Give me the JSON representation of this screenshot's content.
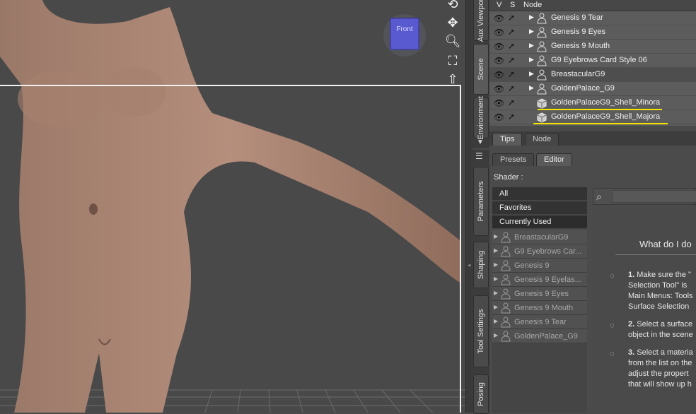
{
  "viewport": {
    "cube_label": "Front"
  },
  "side_tabs_top": [
    {
      "label": "Aux Viewport"
    },
    {
      "label": "Scene"
    },
    {
      "label": "Environment"
    }
  ],
  "side_tabs_bottom": [
    {
      "label": "Parameters"
    },
    {
      "label": "Shaping"
    },
    {
      "label": "Tool Settings"
    },
    {
      "label": "Posing"
    }
  ],
  "scene": {
    "columns": {
      "visible": "V",
      "selectable": "S",
      "node": "Node"
    },
    "rows": [
      {
        "label": "Genesis 9 Tear"
      },
      {
        "label": "Genesis 9 Eyes"
      },
      {
        "label": "Genesis 9 Mouth"
      },
      {
        "label": "G9 Eyebrows Card Style 06"
      },
      {
        "label": "BreastacularG9"
      },
      {
        "label": "GoldenPalace_G9"
      },
      {
        "label": "GoldenPalaceG9_Shell_Minora"
      },
      {
        "label": "GoldenPalaceG9_Shell_Majora"
      }
    ],
    "highlight_color": "#f5e600"
  },
  "bottom_tabs": {
    "tips": "Tips",
    "node": "Node"
  },
  "surfaces": {
    "tabs": {
      "presets": "Presets",
      "editor": "Editor"
    },
    "shader_label": "Shader :",
    "filters": [
      "All",
      "Favorites",
      "Currently Used"
    ],
    "items": [
      {
        "label": "BreastacularG9"
      },
      {
        "label": "G9 Eyebrows Car..."
      },
      {
        "label": "Genesis 9"
      },
      {
        "label": "Genesis 9 Eyelas..."
      },
      {
        "label": "Genesis 9 Eyes"
      },
      {
        "label": "Genesis 9 Mouth"
      },
      {
        "label": "Genesis 9 Tear"
      },
      {
        "label": "GoldenPalace_G9"
      }
    ],
    "help": {
      "title": "What do I do",
      "steps": [
        {
          "num": "1.",
          "lines": [
            "Make sure the \"",
            "Selection Tool\" is",
            "Main Menus: Tools",
            "Surface Selection"
          ]
        },
        {
          "num": "2.",
          "lines": [
            "Select a surface",
            "object in the scene"
          ]
        },
        {
          "num": "3.",
          "lines": [
            "Select a materia",
            "from the list on the",
            "adjust the propert",
            "that will show up h"
          ]
        }
      ]
    }
  }
}
